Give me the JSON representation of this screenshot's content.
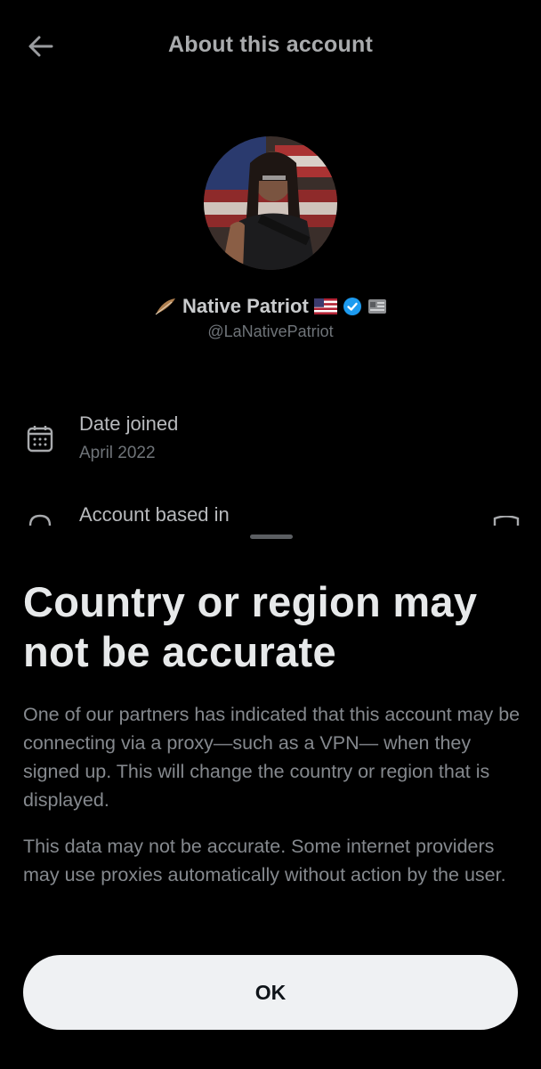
{
  "header": {
    "title": "About this account"
  },
  "profile": {
    "display_name": "Native Patriot",
    "handle": "@LaNativePatriot"
  },
  "info": {
    "date_joined_label": "Date joined",
    "date_joined_value": "April 2022",
    "based_in_label": "Account based in"
  },
  "sheet": {
    "title": "Country or region may not be accurate",
    "paragraph1": "One of our partners has indicated that this account may be connecting via a proxy—such as a VPN— when they signed up. This will change the country or region that is displayed.",
    "paragraph2": "This data may not be accurate. Some internet providers may use proxies automatically without action by the user.",
    "ok_label": "OK"
  },
  "colors": {
    "background": "#000000",
    "verified_badge": "#1d9bf0",
    "button": "#eff1f3"
  },
  "icons": [
    "back-arrow-icon",
    "feather-icon",
    "us-flag-icon",
    "verified-badge-icon",
    "id-card-icon",
    "calendar-icon",
    "location-icon",
    "shield-icon"
  ]
}
